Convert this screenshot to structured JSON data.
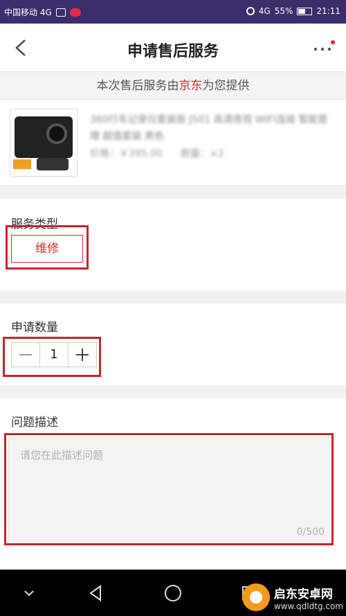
{
  "status_bar": {
    "carrier": "中国移动 4G",
    "network": "4G",
    "battery": "55%",
    "time": "21:11"
  },
  "header": {
    "title": "申请售后服务"
  },
  "provider": {
    "prefix": "本次售后服务由",
    "brand": "京东",
    "suffix": "为您提供"
  },
  "product": {
    "name": "360行车记录仪套装版 J501 高清夜视 WIFI连接 智能管理 超值套装 黑色",
    "price_label": "价格：",
    "price": "￥395.00",
    "qty_label": "数量：",
    "qty": "×2"
  },
  "service": {
    "label": "服务类型",
    "option": "维修"
  },
  "quantity": {
    "label": "申请数量",
    "minus": "−",
    "value": "1",
    "plus": "+"
  },
  "problem": {
    "label": "问题描述",
    "placeholder": "请您在此描述问题",
    "value": "",
    "counter": "0/500"
  },
  "watermark": {
    "title": "启东安卓网",
    "url": "www.qdldtg.com"
  },
  "colors": {
    "accent_red": "#d92b2b",
    "highlight_box": "#c8232c",
    "status_bar": "#3a2e6b"
  }
}
